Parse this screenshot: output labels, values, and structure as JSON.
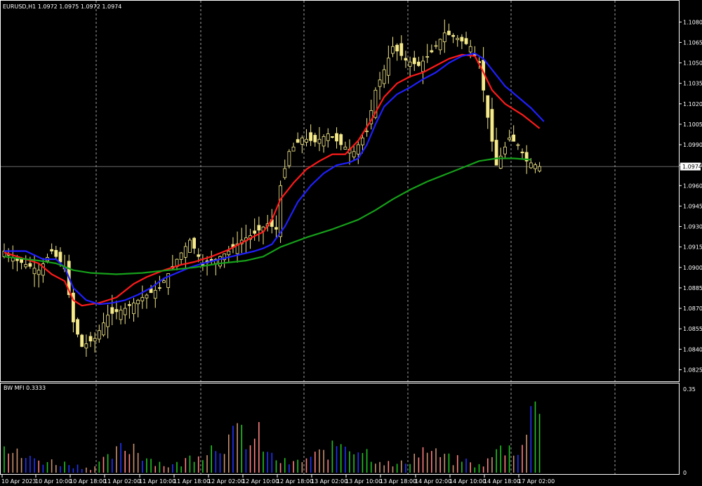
{
  "colors": {
    "background": "#000000",
    "grid": "#c8c8c8",
    "frame": "#ffffff",
    "candle": "#f5e98a",
    "ma_red": "#ff1a1a",
    "ma_blue": "#1f1fff",
    "ma_green": "#16a01a",
    "mfi_green": "#22c422",
    "mfi_blue": "#2233ff",
    "mfi_brown": "#c89070",
    "mfi_pink": "#ff8080",
    "crosshair": "#8c8c8c"
  },
  "chart_data": {
    "type": "candlestick",
    "title": "EURUSD,H1  1.0972 1.0975 1.0972 1.0974",
    "ylim": [
      1.0818,
      1.1092
    ],
    "y_ticks": [
      "1.1080",
      "1.1065",
      "1.1050",
      "1.1035",
      "1.1020",
      "1.1005",
      "1.0990",
      "1.0975",
      "1.0960",
      "1.0945",
      "1.0930",
      "1.0915",
      "1.0900",
      "1.0885",
      "1.0870",
      "1.0855",
      "1.0840",
      "1.0825"
    ],
    "current_price": "1.0974",
    "x_labels": [
      "10 Apr 2023",
      "10 Apr 10:00",
      "10 Apr 18:00",
      "11 Apr 02:00",
      "11 Apr 10:00",
      "11 Apr 18:00",
      "12 Apr 02:00",
      "12 Apr 10:00",
      "12 Apr 18:00",
      "13 Apr 02:00",
      "13 Apr 10:00",
      "13 Apr 18:00",
      "14 Apr 02:00",
      "14 Apr 10:00",
      "14 Apr 18:00",
      "17 Apr 02:00"
    ],
    "close_anchors": [
      [
        0,
        1.0912
      ],
      [
        3,
        1.0905
      ],
      [
        8,
        1.0898
      ],
      [
        11,
        1.0912
      ],
      [
        14,
        1.09
      ],
      [
        16,
        1.086
      ],
      [
        18,
        1.0842
      ],
      [
        21,
        1.0848
      ],
      [
        24,
        1.0865
      ],
      [
        28,
        1.087
      ],
      [
        32,
        1.0878
      ],
      [
        36,
        1.0885
      ],
      [
        40,
        1.0906
      ],
      [
        43,
        1.092
      ],
      [
        46,
        1.0902
      ],
      [
        49,
        1.0906
      ],
      [
        52,
        1.0912
      ],
      [
        55,
        1.092
      ],
      [
        58,
        1.0925
      ],
      [
        61,
        1.0932
      ],
      [
        63,
        1.0928
      ],
      [
        64,
        1.096
      ],
      [
        66,
        1.0985
      ],
      [
        69,
        1.0995
      ],
      [
        72,
        1.0992
      ],
      [
        75,
        1.0998
      ],
      [
        78,
        1.099
      ],
      [
        81,
        1.0985
      ],
      [
        84,
        1.1
      ],
      [
        86,
        1.103
      ],
      [
        88,
        1.1045
      ],
      [
        90,
        1.1062
      ],
      [
        93,
        1.1052
      ],
      [
        96,
        1.1048
      ],
      [
        99,
        1.1058
      ],
      [
        102,
        1.1072
      ],
      [
        105,
        1.1068
      ],
      [
        108,
        1.1062
      ],
      [
        110,
        1.105
      ],
      [
        112,
        1.101
      ],
      [
        114,
        1.0975
      ],
      [
        117,
        1.0995
      ],
      [
        119,
        1.099
      ],
      [
        121,
        1.0978
      ],
      [
        124,
        1.0974
      ]
    ],
    "series": [
      {
        "values": [
          [
            0,
            1.0911
          ],
          [
            8,
            1.0903
          ],
          [
            11,
            1.0895
          ],
          [
            14,
            1.089
          ],
          [
            16,
            1.0876
          ],
          [
            18,
            1.0872
          ],
          [
            22,
            1.0874
          ],
          [
            26,
            1.0878
          ],
          [
            30,
            1.0888
          ],
          [
            33,
            1.0893
          ],
          [
            37,
            1.0898
          ],
          [
            41,
            1.0902
          ],
          [
            44,
            1.0904
          ],
          [
            48,
            1.0908
          ],
          [
            52,
            1.0913
          ],
          [
            55,
            1.0918
          ],
          [
            58,
            1.0923
          ],
          [
            60,
            1.0926
          ],
          [
            62,
            1.0935
          ],
          [
            64,
            1.095
          ],
          [
            67,
            1.0962
          ],
          [
            70,
            1.0972
          ],
          [
            73,
            1.0978
          ],
          [
            76,
            1.0983
          ],
          [
            79,
            1.0983
          ],
          [
            82,
            1.0993
          ],
          [
            85,
            1.1008
          ],
          [
            88,
            1.1025
          ],
          [
            91,
            1.1035
          ],
          [
            94,
            1.104
          ],
          [
            97,
            1.1043
          ],
          [
            100,
            1.1048
          ],
          [
            103,
            1.1053
          ],
          [
            106,
            1.1056
          ],
          [
            109,
            1.1055
          ],
          [
            111,
            1.1043
          ],
          [
            113,
            1.103
          ],
          [
            116,
            1.102
          ],
          [
            120,
            1.1012
          ],
          [
            124,
            1.1002
          ]
        ]
      },
      {
        "values": [
          [
            0,
            1.0912
          ],
          [
            5,
            1.0912
          ],
          [
            9,
            1.0906
          ],
          [
            12,
            1.0906
          ],
          [
            14,
            1.09
          ],
          [
            16,
            1.0885
          ],
          [
            19,
            1.0876
          ],
          [
            22,
            1.0873
          ],
          [
            25,
            1.0874
          ],
          [
            28,
            1.0876
          ],
          [
            31,
            1.088
          ],
          [
            34,
            1.0885
          ],
          [
            37,
            1.0892
          ],
          [
            40,
            1.0896
          ],
          [
            43,
            1.09
          ],
          [
            46,
            1.0903
          ],
          [
            50,
            1.0906
          ],
          [
            54,
            1.0909
          ],
          [
            58,
            1.0912
          ],
          [
            60,
            1.0914
          ],
          [
            62,
            1.0917
          ],
          [
            65,
            1.093
          ],
          [
            68,
            1.0948
          ],
          [
            71,
            1.096
          ],
          [
            74,
            1.0969
          ],
          [
            77,
            1.0975
          ],
          [
            80,
            1.0977
          ],
          [
            82,
            1.098
          ],
          [
            84,
            1.099
          ],
          [
            86,
            1.1005
          ],
          [
            88,
            1.1018
          ],
          [
            91,
            1.1027
          ],
          [
            94,
            1.1032
          ],
          [
            97,
            1.1038
          ],
          [
            100,
            1.1043
          ],
          [
            103,
            1.105
          ],
          [
            106,
            1.1055
          ],
          [
            109,
            1.1057
          ],
          [
            111,
            1.1053
          ],
          [
            113,
            1.1045
          ],
          [
            116,
            1.1033
          ],
          [
            119,
            1.1025
          ],
          [
            122,
            1.1017
          ],
          [
            125,
            1.1007
          ]
        ]
      },
      {
        "values": [
          [
            0,
            1.0908
          ],
          [
            8,
            1.0905
          ],
          [
            12,
            1.0903
          ],
          [
            16,
            1.0898
          ],
          [
            20,
            1.0896
          ],
          [
            26,
            1.0895
          ],
          [
            32,
            1.0896
          ],
          [
            38,
            1.0898
          ],
          [
            44,
            1.09
          ],
          [
            50,
            1.0903
          ],
          [
            56,
            1.0905
          ],
          [
            60,
            1.0908
          ],
          [
            64,
            1.0915
          ],
          [
            70,
            1.0922
          ],
          [
            76,
            1.0928
          ],
          [
            82,
            1.0935
          ],
          [
            86,
            1.0942
          ],
          [
            90,
            1.095
          ],
          [
            94,
            1.0957
          ],
          [
            98,
            1.0963
          ],
          [
            102,
            1.0968
          ],
          [
            106,
            1.0973
          ],
          [
            110,
            1.0978
          ],
          [
            114,
            1.098
          ],
          [
            118,
            1.098
          ],
          [
            122,
            1.0979
          ]
        ]
      }
    ],
    "indicator": {
      "label": "BW MFI 0.3333",
      "ylim": [
        0,
        0.35
      ],
      "y_ticks": [
        "0.35",
        "0"
      ],
      "bars": [
        [
          0,
          0.11,
          "g"
        ],
        [
          3,
          0.08,
          "b"
        ],
        [
          6,
          0.06,
          "br"
        ],
        [
          10,
          0.05,
          "g"
        ],
        [
          14,
          0.04,
          "br"
        ],
        [
          17,
          0.03,
          "b"
        ],
        [
          20,
          0.02,
          "g"
        ],
        [
          24,
          0.06,
          "b"
        ],
        [
          27,
          0.1,
          "b"
        ],
        [
          30,
          0.12,
          "b"
        ],
        [
          32,
          0.08,
          "br"
        ],
        [
          35,
          0.05,
          "g"
        ],
        [
          38,
          0.03,
          "b"
        ],
        [
          41,
          0.04,
          "br"
        ],
        [
          44,
          0.08,
          "g"
        ],
        [
          47,
          0.1,
          "b"
        ],
        [
          50,
          0.13,
          "br"
        ],
        [
          53,
          0.15,
          "g"
        ],
        [
          55,
          0.18,
          "g"
        ],
        [
          57,
          0.12,
          "b"
        ],
        [
          59,
          0.16,
          "br"
        ],
        [
          61,
          0.08,
          "b"
        ],
        [
          64,
          0.05,
          "g"
        ],
        [
          67,
          0.04,
          "br"
        ],
        [
          70,
          0.06,
          "b"
        ],
        [
          73,
          0.08,
          "g"
        ],
        [
          76,
          0.1,
          "b"
        ],
        [
          78,
          0.14,
          "g"
        ],
        [
          80,
          0.12,
          "b"
        ],
        [
          82,
          0.11,
          "br"
        ],
        [
          84,
          0.09,
          "g"
        ],
        [
          86,
          0.06,
          "b"
        ],
        [
          88,
          0.05,
          "br"
        ],
        [
          90,
          0.03,
          "g"
        ],
        [
          92,
          0.04,
          "b"
        ],
        [
          94,
          0.06,
          "br"
        ],
        [
          96,
          0.09,
          "b"
        ],
        [
          98,
          0.1,
          "g"
        ],
        [
          100,
          0.08,
          "b"
        ],
        [
          102,
          0.07,
          "br"
        ],
        [
          104,
          0.05,
          "g"
        ],
        [
          106,
          0.06,
          "b"
        ],
        [
          108,
          0.04,
          "br"
        ],
        [
          110,
          0.03,
          "g"
        ],
        [
          112,
          0.05,
          "b"
        ],
        [
          114,
          0.09,
          "b"
        ],
        [
          116,
          0.11,
          "br"
        ],
        [
          118,
          0.1,
          "g"
        ],
        [
          120,
          0.13,
          "b"
        ],
        [
          121,
          0.16,
          "g"
        ],
        [
          122,
          0.24,
          "g"
        ],
        [
          123,
          0.38,
          "b"
        ]
      ]
    }
  }
}
